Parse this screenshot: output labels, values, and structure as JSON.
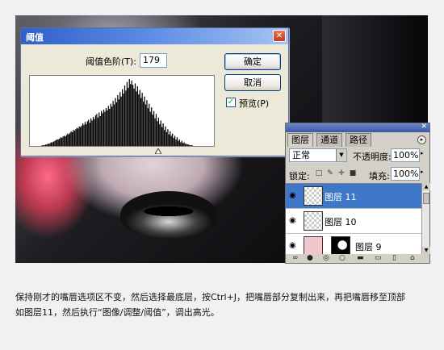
{
  "dialog": {
    "title": "阈值",
    "close_glyph": "✕",
    "level_label": "阈值色阶(T):",
    "level_value": "179",
    "ok_label": "确定",
    "cancel_label": "取消",
    "preview_label": "预览(P)",
    "preview_checked": true,
    "check_glyph": "✓"
  },
  "layers_panel": {
    "close_glyph": "✕",
    "tabs": [
      "图层",
      "通道",
      "路径"
    ],
    "menu_glyph": "▸",
    "blend_mode": "正常",
    "dropdown_glyph": "▼",
    "opacity_label": "不透明度:",
    "opacity_value": "100%",
    "lock_label": "锁定:",
    "lock_icons": [
      "□",
      "✎",
      "✛",
      "■"
    ],
    "fill_label": "填充:",
    "fill_value": "100%",
    "eye_glyph": "◉",
    "layers": [
      {
        "name": "图层 11",
        "selected": true
      },
      {
        "name": "图层 10",
        "selected": false
      },
      {
        "name": "图层 9",
        "selected": false
      }
    ],
    "footer_icons": [
      "∞",
      "●",
      "◎",
      "○",
      "▬",
      "▭",
      "▯",
      "⌂"
    ]
  },
  "histogram": {
    "threshold": 179,
    "bins": [
      0,
      0,
      0,
      0,
      0,
      0,
      0,
      0,
      0,
      0,
      1,
      1,
      1,
      2,
      2,
      3,
      3,
      4,
      5,
      5,
      6,
      7,
      8,
      9,
      9,
      10,
      12,
      11,
      13,
      14,
      13,
      15,
      17,
      16,
      18,
      20,
      19,
      22,
      21,
      23,
      25,
      24,
      27,
      26,
      28,
      31,
      29,
      33,
      30,
      34,
      36,
      32,
      38,
      35,
      40,
      37,
      42,
      44,
      39,
      46,
      41,
      48,
      45,
      50,
      47,
      52,
      49,
      55,
      51,
      58,
      54,
      62,
      57,
      66,
      60,
      70,
      64,
      74,
      68,
      78,
      72,
      83,
      76,
      88,
      80,
      92,
      85,
      90,
      84,
      79,
      86,
      75,
      82,
      71,
      77,
      66,
      73,
      61,
      68,
      57,
      63,
      52,
      58,
      47,
      53,
      43,
      48,
      38,
      44,
      34,
      39,
      30,
      35,
      26,
      31,
      22,
      27,
      19,
      23,
      16,
      20,
      14,
      17,
      11,
      14,
      9,
      12,
      7,
      9,
      5,
      7,
      4,
      5,
      3,
      3,
      2,
      2,
      1,
      1,
      1,
      0,
      0,
      0,
      0,
      0,
      0,
      0,
      0,
      0,
      0,
      0,
      0,
      0,
      0,
      0,
      0,
      0,
      0
    ]
  },
  "caption": {
    "line1": "保持刚才的嘴唇选项区不变，然后选择最底层，按Ctrl+J，把嘴唇部分复制出来，再把嘴唇移至顶部",
    "line2": "如图层11，然后执行“图像/调整/阈值”，调出高光。"
  }
}
